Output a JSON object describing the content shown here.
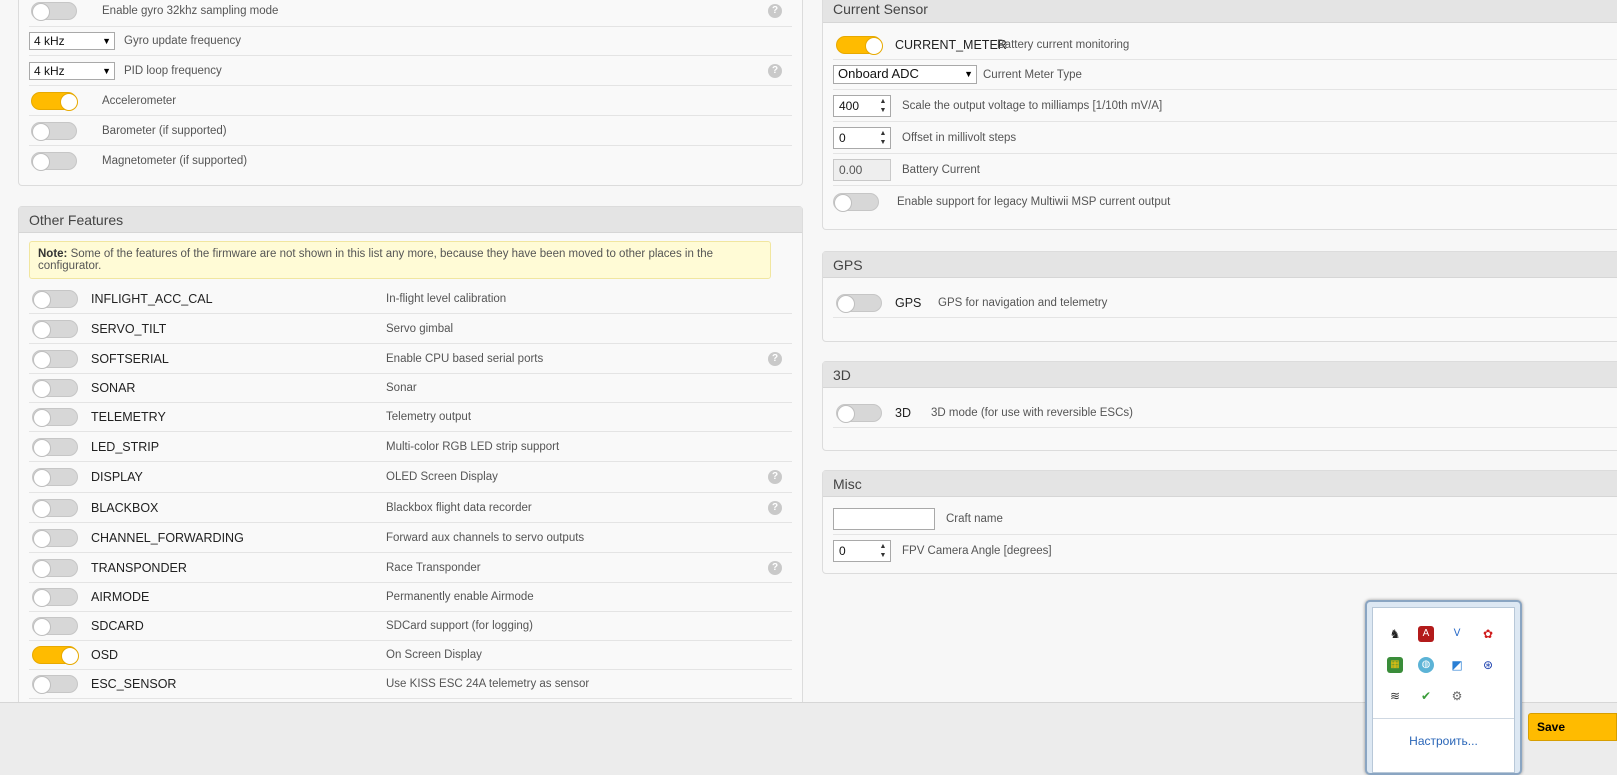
{
  "system_panel": {
    "rows": [
      {
        "label": "Enable gyro 32khz sampling mode",
        "on": false
      },
      {
        "select": "4 kHz",
        "label": "Gyro update frequency"
      },
      {
        "select": "4 kHz",
        "label": "PID loop frequency"
      },
      {
        "label": "Accelerometer",
        "on": true
      },
      {
        "label": "Barometer (if supported)",
        "on": false
      },
      {
        "label": "Magnetometer (if supported)",
        "on": false
      }
    ]
  },
  "other_features": {
    "title": "Other Features",
    "note_bold": "Note:",
    "note_text": " Some of the features of the firmware are not shown in this list any more, because they have been moved to other places in the configurator.",
    "features": [
      {
        "name": "INFLIGHT_ACC_CAL",
        "desc": "In-flight level calibration",
        "on": false
      },
      {
        "name": "SERVO_TILT",
        "desc": "Servo gimbal",
        "on": false
      },
      {
        "name": "SOFTSERIAL",
        "desc": "Enable CPU based serial ports",
        "on": false
      },
      {
        "name": "SONAR",
        "desc": "Sonar",
        "on": false
      },
      {
        "name": "TELEMETRY",
        "desc": "Telemetry output",
        "on": false
      },
      {
        "name": "LED_STRIP",
        "desc": "Multi-color RGB LED strip support",
        "on": false
      },
      {
        "name": "DISPLAY",
        "desc": "OLED Screen Display",
        "on": false
      },
      {
        "name": "BLACKBOX",
        "desc": "Blackbox flight data recorder",
        "on": false
      },
      {
        "name": "CHANNEL_FORWARDING",
        "desc": "Forward aux channels to servo outputs",
        "on": false
      },
      {
        "name": "TRANSPONDER",
        "desc": "Race Transponder",
        "on": false
      },
      {
        "name": "AIRMODE",
        "desc": "Permanently enable Airmode",
        "on": false
      },
      {
        "name": "SDCARD",
        "desc": "SDCard support (for logging)",
        "on": false
      },
      {
        "name": "OSD",
        "desc": "On Screen Display",
        "on": true
      },
      {
        "name": "ESC_SENSOR",
        "desc": "Use KISS ESC 24A telemetry as sensor",
        "on": false
      }
    ]
  },
  "current_sensor": {
    "title": "Current Sensor",
    "meter_name": "CURRENT_METER",
    "meter_desc": "Battery current monitoring",
    "meter_on": true,
    "type_value": "Onboard ADC",
    "type_label": "Current Meter Type",
    "scale_value": "400",
    "scale_label": "Scale the output voltage to milliamps [1/10th mV/A]",
    "offset_value": "0",
    "offset_label": "Offset in millivolt steps",
    "battery_value": "0.00",
    "battery_label": "Battery Current",
    "legacy_label": "Enable support for legacy Multiwii MSP current output",
    "legacy_on": false
  },
  "gps": {
    "title": "GPS",
    "name": "GPS",
    "desc": "GPS for navigation and telemetry",
    "on": false
  },
  "three_d": {
    "title": "3D",
    "name": "3D",
    "desc": "3D mode (for use with reversible ESCs)",
    "on": false
  },
  "misc": {
    "title": "Misc",
    "craft_name_value": "",
    "craft_name_label": "Craft name",
    "fpv_value": "0",
    "fpv_label": "FPV Camera Angle [degrees]"
  },
  "footer": {
    "save_label": "Save"
  },
  "tray": {
    "customize_label": "Настроить...",
    "icons": [
      "ghost-icon",
      "pdf-reader-icon",
      "vk-icon",
      "paw-icon",
      "archive-icon",
      "globe-icon",
      "screenshot-icon",
      "network-icon",
      "wifi-off-icon",
      "usb-safe-remove-icon",
      "gear-cluster-icon"
    ]
  }
}
